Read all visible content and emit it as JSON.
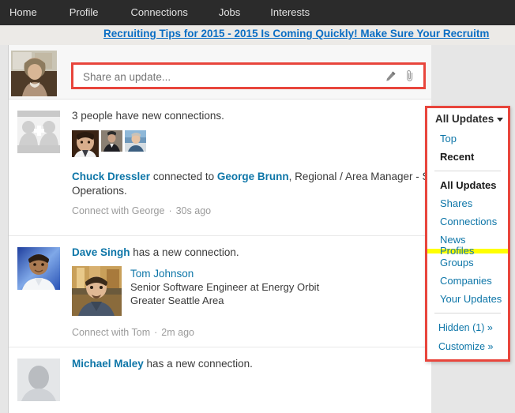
{
  "nav": {
    "items": [
      {
        "label": "Home"
      },
      {
        "label": "Profile"
      },
      {
        "label": "Connections"
      },
      {
        "label": "Jobs"
      },
      {
        "label": "Interests"
      }
    ]
  },
  "banner": {
    "link_text": "Recruiting Tips for 2015 - 2015 Is Coming Quickly! Make Sure Your Recruitm"
  },
  "share": {
    "placeholder": "Share an update...",
    "value": "",
    "pencil_icon": "pencil-icon",
    "attach_icon": "paperclip-icon"
  },
  "feed": {
    "items": [
      {
        "avatar_icon": "add-connections-placeholder-icon",
        "headline": "3 people have new connections.",
        "thumbnails": [
          "avatar-thumb-1",
          "avatar-thumb-2",
          "avatar-thumb-3"
        ],
        "sentence_actor": "Chuck Dressler",
        "sentence_mid": " connected to ",
        "sentence_target": "George Brunn",
        "sentence_tail": ", Regional / Area Manager - Sal",
        "sentence_line2": "Operations.",
        "action": "Connect with George",
        "time": "30s ago"
      },
      {
        "avatar_icon": "dave-singh-avatar",
        "actor": "Dave Singh",
        "headline_rest": " has a new connection.",
        "person": {
          "photo_icon": "tom-johnson-photo",
          "name": "Tom Johnson",
          "title": "Senior Software Engineer at Energy Orbit",
          "location": "Greater Seattle Area"
        },
        "action": "Connect with Tom",
        "time": "2m ago"
      },
      {
        "avatar_icon": "michael-maley-avatar",
        "actor": "Michael Maley",
        "headline_rest": " has a new connection."
      }
    ]
  },
  "dropdown": {
    "header": "All Updates",
    "top": "Top",
    "recent": "Recent",
    "items": [
      {
        "label": "All Updates",
        "style": "bold"
      },
      {
        "label": "Shares",
        "style": "link"
      },
      {
        "label": "Connections",
        "style": "link"
      },
      {
        "label": "News",
        "style": "link"
      },
      {
        "label": "Profiles",
        "style": "highlight"
      },
      {
        "label": "Groups",
        "style": "link"
      },
      {
        "label": "Companies",
        "style": "link"
      },
      {
        "label": "Your Updates",
        "style": "link"
      }
    ],
    "hidden": "Hidden (1) »",
    "customize": "Customize »"
  },
  "colors": {
    "nav_bg": "#2b2b2b",
    "link_blue": "#0e76a8",
    "banner_blue": "#0b6ec4",
    "highlight_red": "#e8453c",
    "highlight_yellow": "#ffff00",
    "page_bg": "#e6e6e6"
  }
}
